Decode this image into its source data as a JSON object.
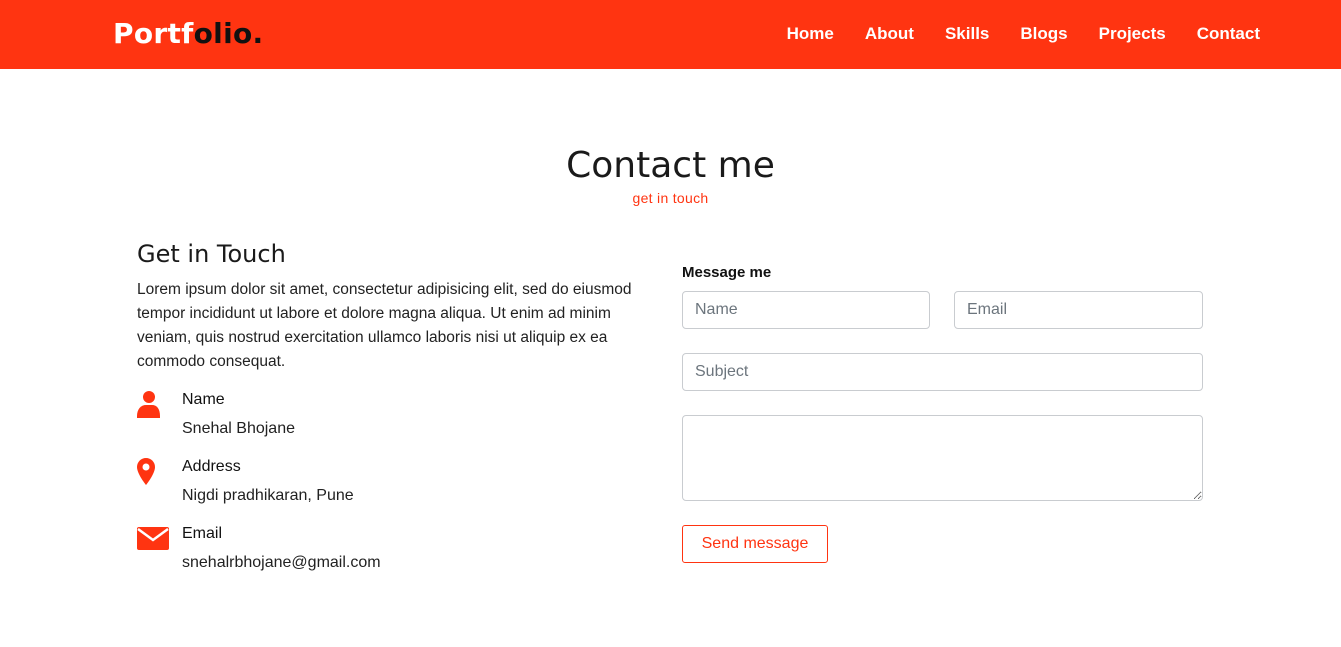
{
  "brand": {
    "logo_main": "Portf",
    "logo_accent": "olio.",
    "accent_color": "#ff3411"
  },
  "nav": {
    "items": [
      "Home",
      "About",
      "Skills",
      "Blogs",
      "Projects",
      "Contact"
    ]
  },
  "section": {
    "title": "Contact me",
    "subtitle": "get in touch"
  },
  "get_in_touch": {
    "title": "Get in Touch",
    "text": "Lorem ipsum dolor sit amet, consectetur adipisicing elit, sed do eiusmod tempor incididunt ut labore et dolore magna aliqua. Ut enim ad minim veniam, quis nostrud exercitation ullamco laboris nisi ut aliquip ex ea commodo consequat.",
    "items": [
      {
        "icon": "user-icon",
        "label": "Name",
        "value": "Snehal Bhojane"
      },
      {
        "icon": "map-marker-icon",
        "label": "Address",
        "value": "Nigdi pradhikaran, Pune"
      },
      {
        "icon": "envelope-icon",
        "label": "Email",
        "value": "snehalrbhojane@gmail.com"
      }
    ]
  },
  "form": {
    "heading": "Message me",
    "name_placeholder": "Name",
    "email_placeholder": "Email",
    "subject_placeholder": "Subject",
    "message_value": "",
    "send_label": "Send message"
  }
}
